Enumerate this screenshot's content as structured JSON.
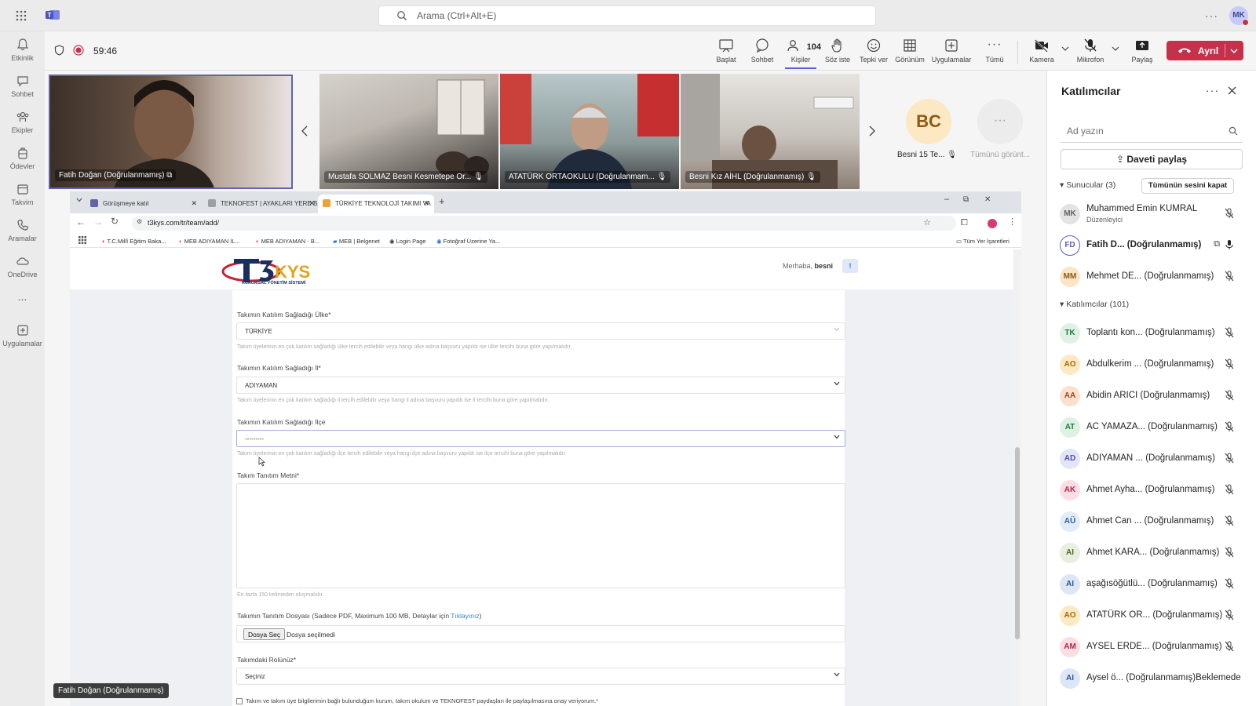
{
  "topbar": {
    "search_placeholder": "Arama (Ctrl+Alt+E)",
    "user_initials": "MK"
  },
  "rail": {
    "items": [
      {
        "label": "Etkinlik"
      },
      {
        "label": "Sohbet"
      },
      {
        "label": "Ekipler"
      },
      {
        "label": "Ödevler"
      },
      {
        "label": "Takvim"
      },
      {
        "label": "Aramalar"
      },
      {
        "label": "OneDrive"
      },
      {
        "label": "..."
      },
      {
        "label": "Uygulamalar"
      }
    ]
  },
  "meeting": {
    "timer": "59:46",
    "people_count": "104",
    "tools": [
      {
        "label": "Başlat"
      },
      {
        "label": "Sohbet"
      },
      {
        "label": "Kişiler"
      },
      {
        "label": "Söz iste"
      },
      {
        "label": "Tepki ver"
      },
      {
        "label": "Görünüm"
      },
      {
        "label": "Uygulamalar"
      },
      {
        "label": "Tümü"
      },
      {
        "label": "Kamera"
      },
      {
        "label": "Mikrofon"
      },
      {
        "label": "Paylaş"
      }
    ],
    "leave_label": "Ayrıl"
  },
  "videos": [
    {
      "name": "Fatih Doğan (Doğrulanmamış)"
    },
    {
      "name": "Mustafa SOLMAZ Besni Kesmetepe Or..."
    },
    {
      "name": "ATATÜRK ORTAOKULU (Doğrulanmam..."
    },
    {
      "name": "Besni Kız AİHL (Doğrulanmamış)"
    }
  ],
  "overflow_tiles": {
    "bc_initials": "BC",
    "bc_name": "Besni 15 Te...",
    "more_label": "Tümünü görünt..."
  },
  "browser": {
    "tabs": [
      {
        "label": "Görüşmeye katıl"
      },
      {
        "label": "TEKNOFEST | AYAKLARI YERE B"
      },
      {
        "label": "TÜRKİYE TEKNOLOJİ TAKIMI VA"
      }
    ],
    "url": "t3kys.com/tr/team/add/",
    "bookmarks": [
      {
        "label": "T.C.Millî Eğitim Baka..."
      },
      {
        "label": "MEB ADIYAMAN İL..."
      },
      {
        "label": "MEB ADIYAMAN - B..."
      },
      {
        "label": "MEB | Belgenet"
      },
      {
        "label": "Login Page"
      },
      {
        "label": "Fotoğraf Üzerine Ya..."
      }
    ],
    "bookmarks_all": "Tüm Yer İşaretleri"
  },
  "site": {
    "logo_main": "T3KYS",
    "logo_sub": "KURUMSAL YÖNETİM SİSTEMİ",
    "greeting_prefix": "Merhaba,",
    "greeting_user": "besni",
    "notify_badge": "!",
    "form": {
      "country_label": "Takımın Katılım Sağladığı Ülke*",
      "country_value": "TÜRKİYE",
      "country_help": "Takım üyelerinin en çok katılım sağladığı ülke tercih edilebilir veya hangi ülke adına başvuru yapıldı ise ülke tercihi buna göre yapılmalıdır.",
      "city_label": "Takımın Katılım Sağladığı İl*",
      "city_value": "ADIYAMAN",
      "city_help": "Takım üyelerinin en çok katılım sağladığı il tercih edilebilir veya hangi il adına başvuru yapıldı ise il tercihi buna göre yapılmalıdır.",
      "district_label": "Takımın Katılım Sağladığı İlçe",
      "district_value": "---------",
      "district_help": "Takım üyelerinin en çok katılım sağladığı ilçe tercih edilebilir veya hangi ilçe adına başvuru yapıldı ise ilçe tercihi buna göre yapılmalıdır.",
      "intro_label": "Takım Tanıtım Metni*",
      "intro_help": "En fazla 150 kelimeden oluşmalıdır.",
      "file_label": "Takımın Tanıtım Dosyası (Sadece PDF, Maximum 100 MB, Detaylar için",
      "file_link": "Tıklayınız",
      "file_label_end": ")",
      "file_button": "Dosya Seç",
      "file_status": "Dosya seçilmedi",
      "role_label": "Takımdaki Rolünüz*",
      "role_value": "Seçiniz",
      "consent": "Takım ve takım üye bilgilerimin bağlı bulunduğum kurum, takım okulum ve TEKNOFEST paydaşları ile paylaşılmasına onay veriyorum.*"
    }
  },
  "tooltip": "Fatih Doğan (Doğrulanmamış)",
  "panel": {
    "title": "Katılımcılar",
    "search_placeholder": "Ad yazın",
    "invite_label": "Daveti paylaş",
    "presenters_header": "Sunucular (3)",
    "mute_all": "Tümünün sesini kapat",
    "attendees_header": "Katılımcılar (101)",
    "presenters": [
      {
        "initials": "MK",
        "name": "Muhammed Emin KUMRAL",
        "sub": "Düzenleyici",
        "color": "#e3e3e3",
        "fg": "#616161"
      },
      {
        "initials": "FD",
        "name": "Fatih D...  (Doğrulanmamış)",
        "sub": "",
        "color": "#ffffff",
        "fg": "#5b5fc7"
      },
      {
        "initials": "MM",
        "name": "Mehmet DE...  (Doğrulanmamış)",
        "sub": "",
        "color": "#fce4c6",
        "fg": "#8a5a14"
      }
    ],
    "attendees": [
      {
        "initials": "TK",
        "name": "Toplantı kon...  (Doğrulanmamış)",
        "color": "#dff1e5",
        "fg": "#1a7f37"
      },
      {
        "initials": "AO",
        "name": "Abdulkerim ...  (Doğrulanmamış)",
        "color": "#fde9c4",
        "fg": "#a36b00"
      },
      {
        "initials": "AA",
        "name": "Abidin ARICI (Doğrulanmamış)",
        "color": "#fbe0d0",
        "fg": "#a3461a"
      },
      {
        "initials": "AT",
        "name": "AC YAMAZA...  (Doğrulanmamış)",
        "color": "#dff1e5",
        "fg": "#1a7f37"
      },
      {
        "initials": "AD",
        "name": "ADIYAMAN ...  (Doğrulanmamış)",
        "color": "#e4e4f7",
        "fg": "#4f52b2"
      },
      {
        "initials": "AK",
        "name": "Ahmet Ayha...  (Doğrulanmamış)",
        "color": "#fbdde3",
        "fg": "#b0254a"
      },
      {
        "initials": "AÜ",
        "name": "Ahmet Can ...  (Doğrulanmamış)",
        "color": "#e2ecf7",
        "fg": "#2b5f9e"
      },
      {
        "initials": "AI",
        "name": "Ahmet KARA...  (Doğrulanmamış)",
        "color": "#e8eee0",
        "fg": "#4d6b24"
      },
      {
        "initials": "AI",
        "name": "aşağısöğütlü...  (Doğrulanmamış)",
        "color": "#dde6f4",
        "fg": "#2f5597"
      },
      {
        "initials": "AO",
        "name": "ATATÜRK OR...  (Doğrulanmamış)",
        "color": "#fde9c4",
        "fg": "#a36b00"
      },
      {
        "initials": "AM",
        "name": "AYSEL ERDE...  (Doğrulanmamış)",
        "color": "#fbdde3",
        "fg": "#b0254a"
      },
      {
        "initials": "AI",
        "name": "Aysel ö...  (Doğrulanmamış)Beklemede",
        "color": "#dde6f4",
        "fg": "#2f5597"
      }
    ]
  }
}
